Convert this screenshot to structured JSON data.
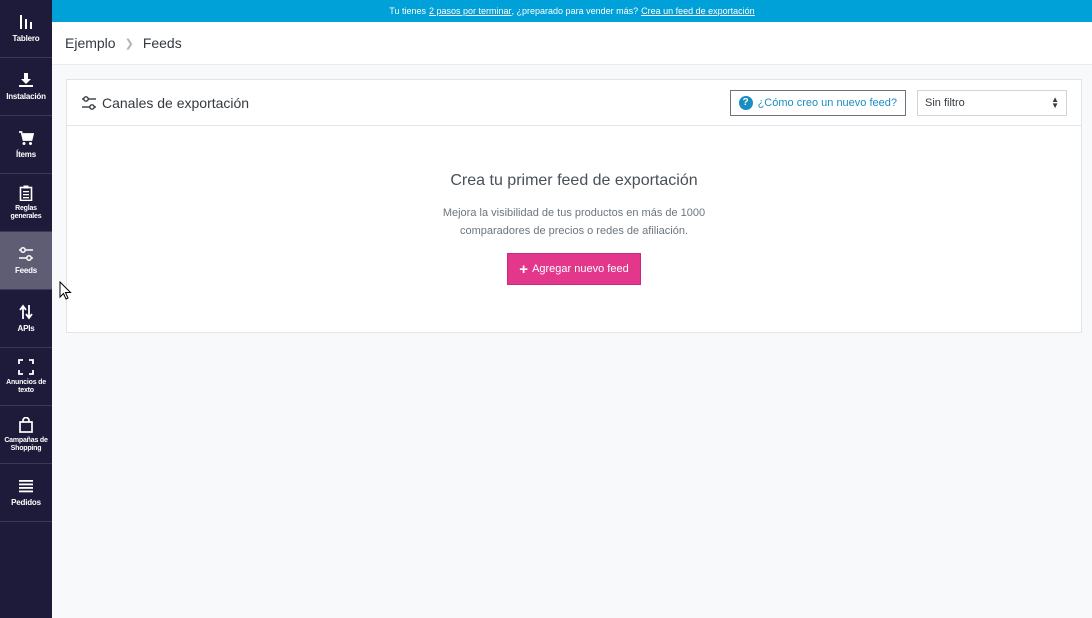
{
  "sidebar": {
    "items": [
      {
        "label": "Tablero",
        "icon": "bar-chart-icon"
      },
      {
        "label": "Instalación",
        "icon": "download-icon"
      },
      {
        "label": "Ítems",
        "icon": "cart-icon"
      },
      {
        "label": "Reglas generales",
        "icon": "clipboard-icon"
      },
      {
        "label": "Feeds",
        "icon": "sliders-icon",
        "active": true
      },
      {
        "label": "APIs",
        "icon": "swap-arrows-icon"
      },
      {
        "label": "Anuncios de texto",
        "icon": "expand-icon"
      },
      {
        "label": "Campañas de Shopping",
        "icon": "shopping-bag-icon"
      },
      {
        "label": "Pedidos",
        "icon": "list-icon"
      }
    ]
  },
  "banner": {
    "prefix": "Tu tienes",
    "steps_link": "2 pasos por terminar",
    "middle": ", ¿preparado para vender más?",
    "cta_link": "Crea un feed de exportación"
  },
  "breadcrumb": {
    "root": "Ejemplo",
    "current": "Feeds"
  },
  "card": {
    "title": "Canales de exportación",
    "help_label": "¿Cómo creo un nuevo feed?",
    "filter_value": "Sin filtro",
    "empty_title": "Crea tu primer feed de exportación",
    "empty_line1": "Mejora la visibilidad de tus productos en más de 1000",
    "empty_line2": "comparadores de precios o redes de afiliación.",
    "add_label": "Agregar nuevo feed"
  },
  "colors": {
    "sidebar": "#1e1b3a",
    "banner": "#00a0d8",
    "accent": "#e3378c",
    "link": "#1a8ec2"
  }
}
